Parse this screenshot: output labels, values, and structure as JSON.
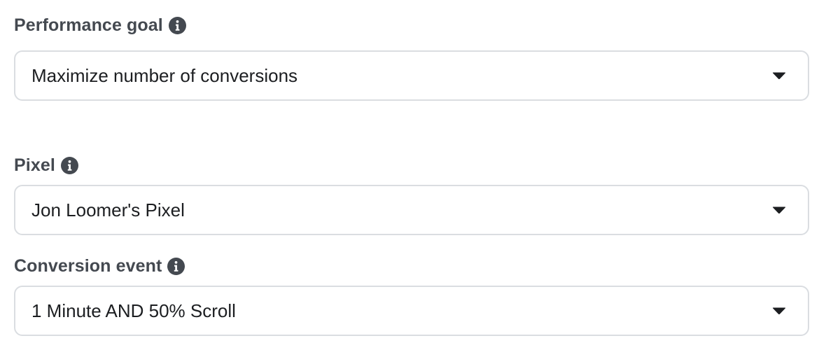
{
  "fields": {
    "performance_goal": {
      "label": "Performance goal",
      "value": "Maximize number of conversions"
    },
    "pixel": {
      "label": "Pixel",
      "value": "Jon Loomer's Pixel"
    },
    "conversion_event": {
      "label": "Conversion event",
      "value": "1 Minute AND 50% Scroll"
    }
  },
  "icons": {
    "info": "info-icon",
    "dropdown": "caret-down-icon"
  },
  "colors": {
    "label_text": "#444950",
    "value_text": "#1c1e21",
    "border": "#dadde1",
    "icon": "#444950"
  }
}
